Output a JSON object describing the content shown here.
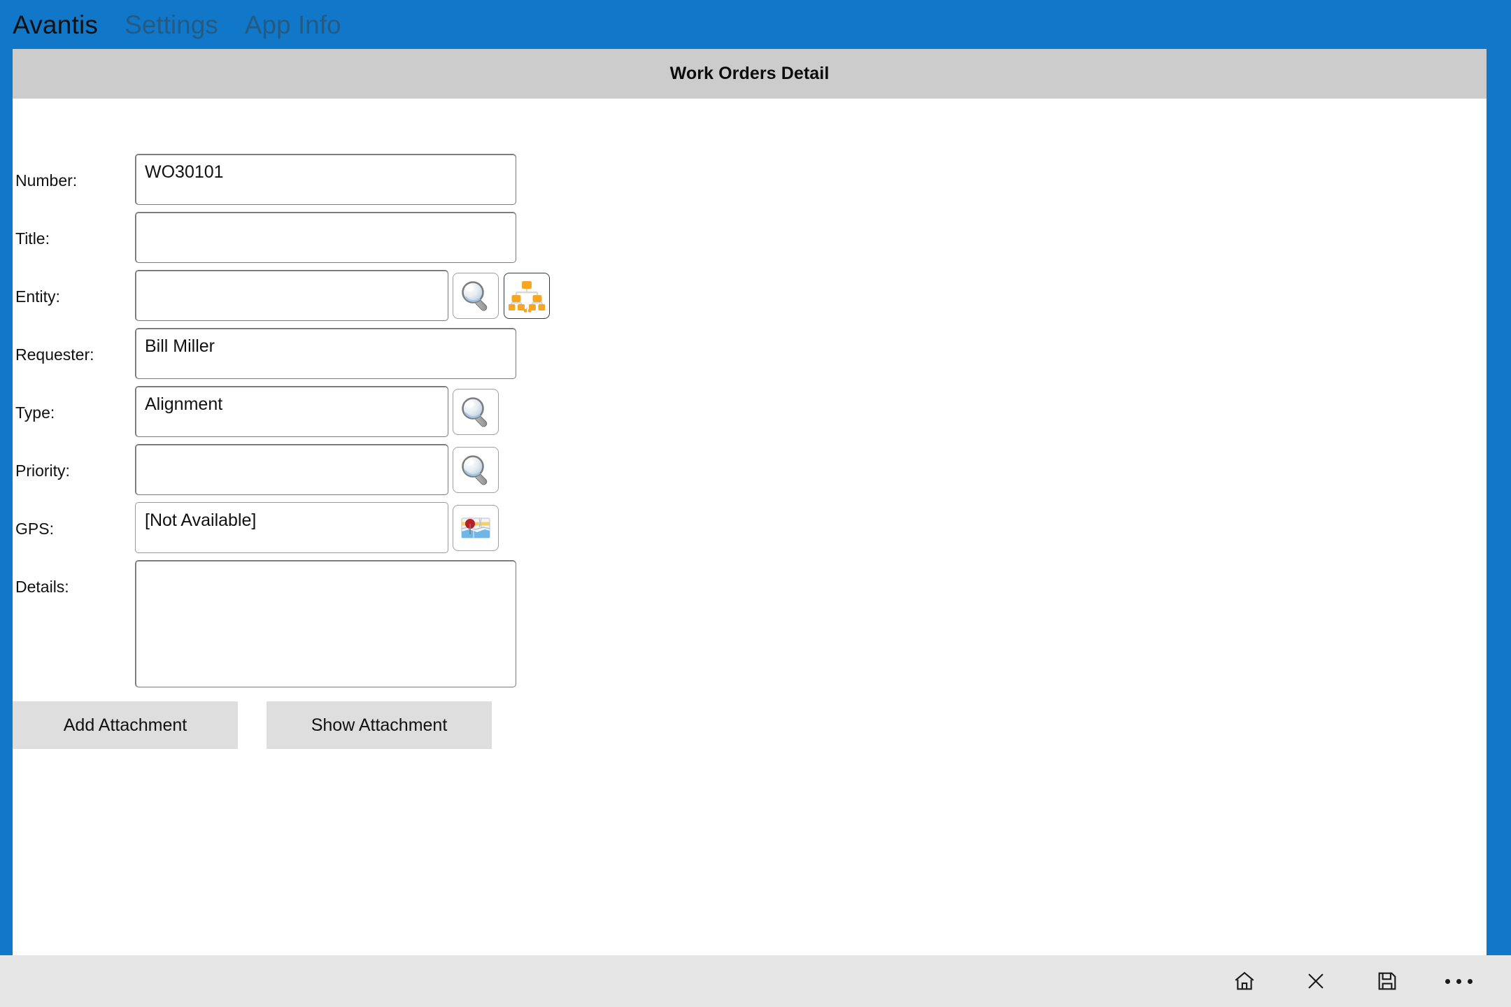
{
  "appbar": {
    "brand": "Avantis",
    "links": [
      {
        "label": "Settings"
      },
      {
        "label": "App Info"
      }
    ]
  },
  "section": {
    "title": "Work Orders Detail"
  },
  "form": {
    "fields": [
      {
        "label": "Number:",
        "value": "WO30101",
        "placeholder": "",
        "icons": []
      },
      {
        "label": "Title:",
        "value": "",
        "placeholder": "",
        "icons": []
      },
      {
        "label": "Entity:",
        "value": "",
        "placeholder": "",
        "icons": [
          "search-icon",
          "hierarchy-icon"
        ]
      },
      {
        "label": "Requester:",
        "value": "Bill Miller",
        "placeholder": "",
        "icons": []
      },
      {
        "label": "Type:",
        "value": "Alignment",
        "placeholder": "",
        "icons": [
          "search-icon"
        ]
      },
      {
        "label": "Priority:",
        "value": "",
        "placeholder": "",
        "icons": [
          "search-icon"
        ]
      },
      {
        "label": "GPS:",
        "value": "[Not Available]",
        "placeholder": "",
        "icons": [
          "map-icon"
        ]
      },
      {
        "label": "Details:",
        "value": "",
        "placeholder": "",
        "icons": []
      }
    ]
  },
  "actions": {
    "add_attachment": "Add Attachment",
    "show_attachment": "Show Attachment"
  },
  "commandbar": {
    "items": [
      {
        "name": "home-icon"
      },
      {
        "name": "close-icon"
      },
      {
        "name": "save-icon"
      },
      {
        "name": "more-icon"
      }
    ]
  },
  "colors": {
    "accent_blue": "#1077c9",
    "header_gray": "#cccccc",
    "command_bar_gray": "#e6e6e6",
    "button_gray": "#dedede",
    "icon_orange": "#f5a623"
  }
}
